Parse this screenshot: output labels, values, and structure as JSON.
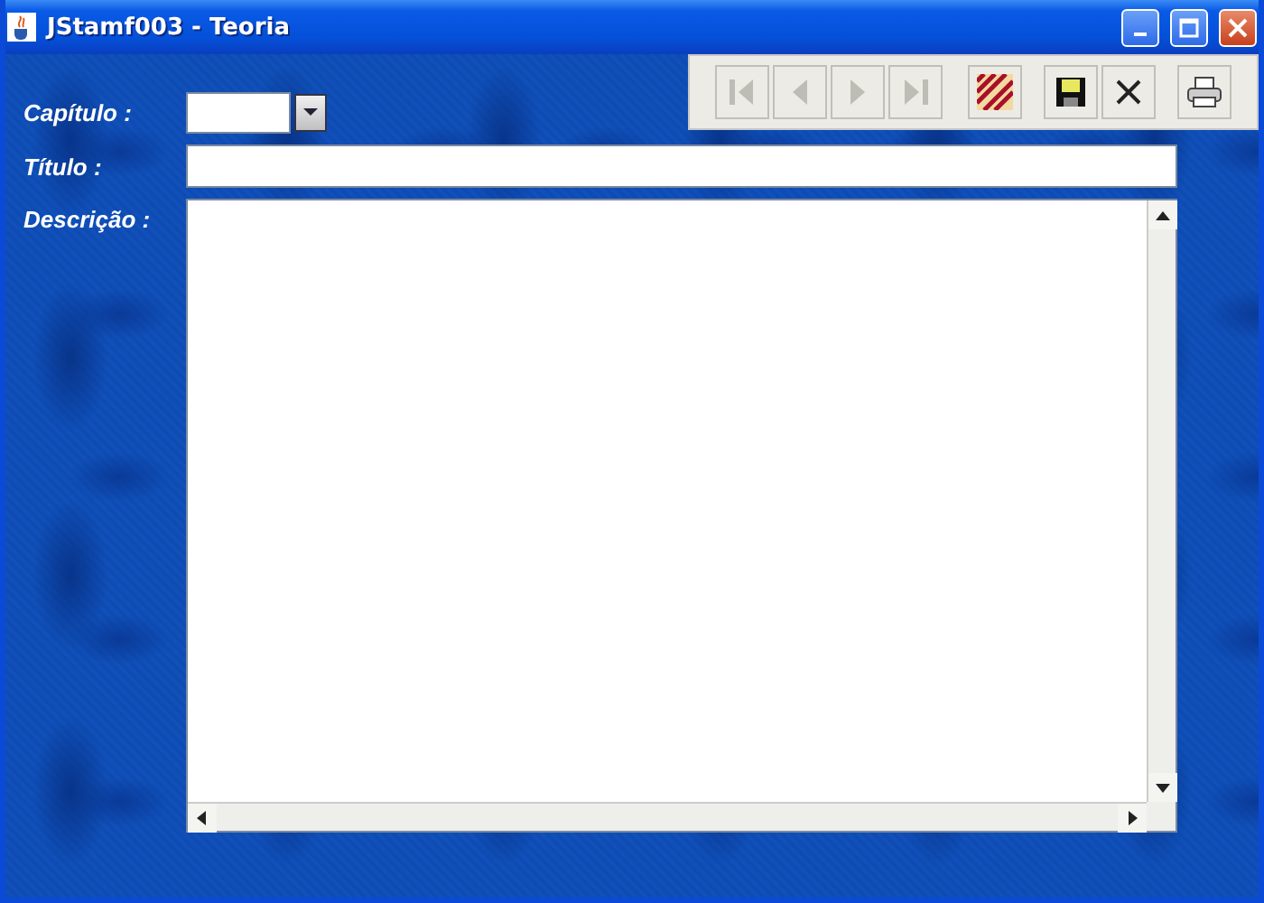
{
  "window": {
    "title": "JStamf003 - Teoria"
  },
  "toolbar": [
    {
      "kind": "first",
      "disabled": true
    },
    {
      "kind": "previous",
      "disabled": true
    },
    {
      "kind": "next",
      "disabled": true
    },
    {
      "kind": "last",
      "disabled": true
    },
    {
      "kind": "clear",
      "disabled": false
    },
    {
      "kind": "save",
      "disabled": false
    },
    {
      "kind": "cancel",
      "disabled": false
    },
    {
      "kind": "print",
      "disabled": false
    }
  ],
  "form": {
    "chapter_label": "Capítulo :",
    "title_label": "Título :",
    "description_label": "Descrição :"
  }
}
